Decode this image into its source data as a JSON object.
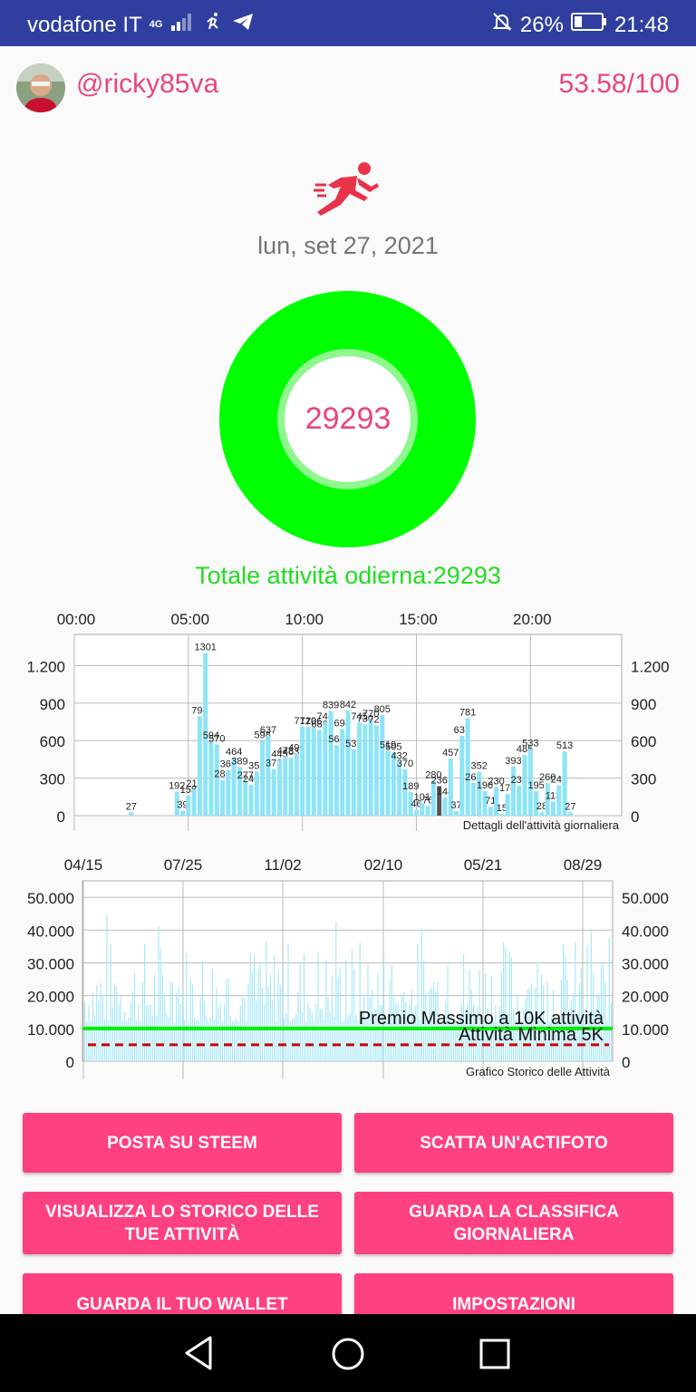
{
  "status_bar": {
    "carrier": "vodafone IT",
    "network_type": "4G",
    "battery": "26%",
    "time": "21:48"
  },
  "header": {
    "username": "@ricky85va",
    "score": "53.58/100"
  },
  "activity": {
    "date": "lun, set 27, 2021",
    "today_count": "29293",
    "today_label": "Totale attività odierna:29293"
  },
  "colors": {
    "accent_pink": "#e8467a",
    "button_pink": "#ff4081",
    "ring_green": "#00ff00",
    "bar_cyan": "#8ee4f7",
    "status_bar_blue": "#303f9f"
  },
  "chart_data": [
    {
      "type": "bar",
      "description": "Dettagli dell'attività giornaliera",
      "x_tick_labels": [
        "00:00",
        "05:00",
        "10:00",
        "15:00",
        "20:00"
      ],
      "y_tick_labels": [
        "0",
        "300",
        "600",
        "900",
        "1.200"
      ],
      "ylim": [
        0,
        1450
      ],
      "xlim_hours": [
        0,
        24
      ],
      "grid": true,
      "x": [
        2.5,
        4.5,
        4.75,
        5.0,
        5.25,
        5.5,
        5.75,
        6.0,
        6.25,
        6.5,
        6.75,
        7.0,
        7.25,
        7.5,
        7.75,
        8.0,
        8.25,
        8.5,
        8.75,
        9.0,
        9.25,
        9.5,
        9.75,
        10.0,
        10.25,
        10.5,
        10.75,
        11.0,
        11.25,
        11.5,
        11.75,
        12.0,
        12.25,
        12.5,
        12.75,
        13.0,
        13.25,
        13.5,
        13.75,
        14.0,
        14.25,
        14.5,
        14.75,
        15.0,
        15.25,
        15.5,
        15.75,
        16.0,
        16.25,
        16.5,
        16.75,
        17.0,
        17.25,
        17.5,
        17.75,
        18.0,
        18.25,
        18.5,
        18.75,
        19.0,
        19.25,
        19.5,
        19.75,
        20.0,
        20.25,
        20.5,
        20.75,
        21.0,
        21.25,
        21.5,
        21.75
      ],
      "values": [
        27,
        192,
        39,
        158,
        211,
        794,
        1301,
        594,
        570,
        285,
        365,
        464,
        389,
        277,
        246,
        352,
        598,
        637,
        372,
        445,
        473,
        463,
        496,
        712,
        710,
        706,
        686,
        748,
        839,
        564,
        694,
        842,
        531,
        745,
        730,
        770,
        722,
        805,
        519,
        505,
        432,
        370,
        189,
        46,
        101,
        76,
        280,
        236,
        144,
        457,
        37,
        637,
        781,
        261,
        352,
        196,
        71,
        230,
        15,
        174,
        393,
        238,
        485,
        533,
        195,
        28,
        260,
        113,
        242,
        513,
        27
      ],
      "highlight_index": 47
    },
    {
      "type": "bar",
      "description": "Grafico Storico delle Attività",
      "x_tick_labels": [
        "04/15",
        "07/25",
        "11/02",
        "02/10",
        "05/21",
        "08/29"
      ],
      "y_tick_labels": [
        "0",
        "10.000",
        "20.000",
        "30.000",
        "40.000",
        "50.000"
      ],
      "ylim": [
        0,
        55000
      ],
      "grid": true,
      "reference_lines": [
        {
          "label": "Premio Massimo a 10K attività",
          "value": 10000,
          "color": "#00ee00",
          "style": "solid"
        },
        {
          "label": "Attività Minima 5K",
          "value": 5000,
          "color": "#cc0000",
          "style": "dashed"
        }
      ],
      "series_summary": "daily totals ranging roughly 10.000-50.000"
    }
  ],
  "buttons": [
    {
      "label": "POSTA SU STEEM"
    },
    {
      "label": "SCATTA UN'ACTIFOTO"
    },
    {
      "label": "VISUALIZZA LO STORICO DELLE TUE ATTIVITÀ"
    },
    {
      "label": "GUARDA LA CLASSIFICA GIORNALIERA"
    },
    {
      "label": "GUARDA IL TUO WALLET"
    },
    {
      "label": "IMPOSTAZIONI"
    }
  ]
}
